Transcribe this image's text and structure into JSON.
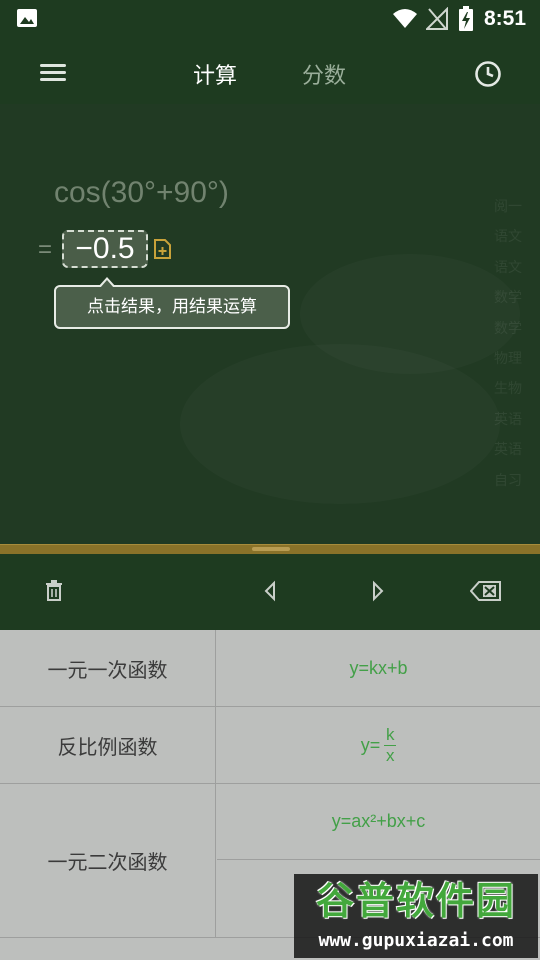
{
  "status_bar": {
    "time": "8:51",
    "icons": [
      "gallery-icon",
      "wifi-icon",
      "no-signal-icon",
      "battery-charging-icon"
    ]
  },
  "app_bar": {
    "menu_icon": "hamburger-menu-icon",
    "tabs": [
      {
        "label": "计算",
        "active": true
      },
      {
        "label": "分数",
        "active": false
      }
    ],
    "history_icon": "clock-icon"
  },
  "board": {
    "expression": "cos(30°+90°)",
    "equals": "=",
    "result": "−0.5",
    "copy_icon": "add-to-clipboard-icon",
    "tooltip": "点击结果，用结果运算",
    "faint_background_text": [
      "阅一",
      "语文",
      "语文",
      "数学",
      "数学",
      "物理",
      "生物",
      "英语",
      "英语",
      "自习"
    ]
  },
  "toolbar": {
    "icons": [
      "trash-icon",
      "cursor-left-icon",
      "cursor-right-icon",
      "backspace-icon"
    ]
  },
  "formulas": [
    {
      "name": "一元一次函数",
      "formula": "y=kx+b"
    },
    {
      "name": "反比例函数",
      "formula_prefix": "y=",
      "numerator": "k",
      "denominator": "x"
    },
    {
      "name": "一元二次函数",
      "formula": "y=ax²+bx+c"
    }
  ],
  "watermark": {
    "title": "谷普软件园",
    "url": "www.gupuxiazai.com"
  },
  "colors": {
    "board": "#213a23",
    "bar": "#1e3b20",
    "ledge": "#8a7229",
    "formula_green": "#43a048",
    "table_bg": "#bdbfbd"
  }
}
